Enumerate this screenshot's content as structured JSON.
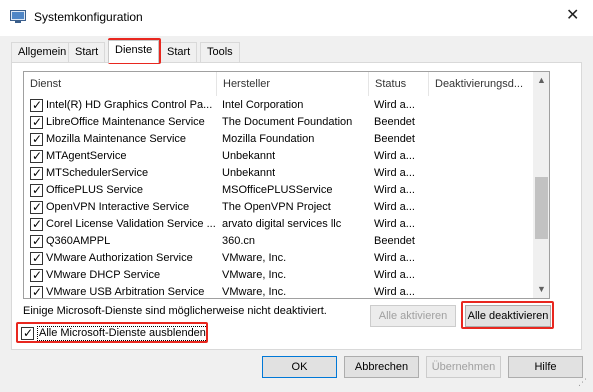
{
  "window": {
    "title": "Systemkonfiguration",
    "close_glyph": "✕"
  },
  "tabs": [
    "Allgemein",
    "Start",
    "Dienste",
    "Start",
    "Tools"
  ],
  "active_tab_index": 2,
  "services": {
    "columns": [
      "Dienst",
      "Hersteller",
      "Status",
      "Deaktivierungsd..."
    ],
    "rows": [
      {
        "checked": true,
        "name": "Intel(R) HD Graphics Control Pa...",
        "vendor": "Intel Corporation",
        "status": "Wird a..."
      },
      {
        "checked": true,
        "name": "LibreOffice Maintenance Service",
        "vendor": "The Document Foundation",
        "status": "Beendet"
      },
      {
        "checked": true,
        "name": "Mozilla Maintenance Service",
        "vendor": "Mozilla Foundation",
        "status": "Beendet"
      },
      {
        "checked": true,
        "name": "MTAgentService",
        "vendor": "Unbekannt",
        "status": "Wird a..."
      },
      {
        "checked": true,
        "name": "MTSchedulerService",
        "vendor": "Unbekannt",
        "status": "Wird a..."
      },
      {
        "checked": true,
        "name": "OfficePLUS Service",
        "vendor": "MSOfficePLUSService",
        "status": "Wird a..."
      },
      {
        "checked": true,
        "name": "OpenVPN Interactive Service",
        "vendor": "The OpenVPN Project",
        "status": "Wird a..."
      },
      {
        "checked": true,
        "name": "Corel License Validation Service ...",
        "vendor": "arvato digital services llc",
        "status": "Wird a..."
      },
      {
        "checked": true,
        "name": "Q360AMPPL",
        "vendor": "360.cn",
        "status": "Beendet"
      },
      {
        "checked": true,
        "name": "VMware Authorization Service",
        "vendor": "VMware, Inc.",
        "status": "Wird a..."
      },
      {
        "checked": true,
        "name": "VMware DHCP Service",
        "vendor": "VMware, Inc.",
        "status": "Wird a..."
      },
      {
        "checked": true,
        "name": "VMware USB Arbitration Service",
        "vendor": "VMware, Inc.",
        "status": "Wird a..."
      }
    ]
  },
  "note": "Einige Microsoft-Dienste sind möglicherweise nicht deaktiviert.",
  "buttons": {
    "enable_all": "Alle aktivieren",
    "disable_all": "Alle deaktivieren",
    "ok": "OK",
    "cancel": "Abbrechen",
    "apply": "Übernehmen",
    "help": "Hilfe"
  },
  "hide_microsoft": {
    "checked": true,
    "label": "Alle Microsoft-Dienste ausblenden"
  },
  "highlight_color": "#e8271f"
}
